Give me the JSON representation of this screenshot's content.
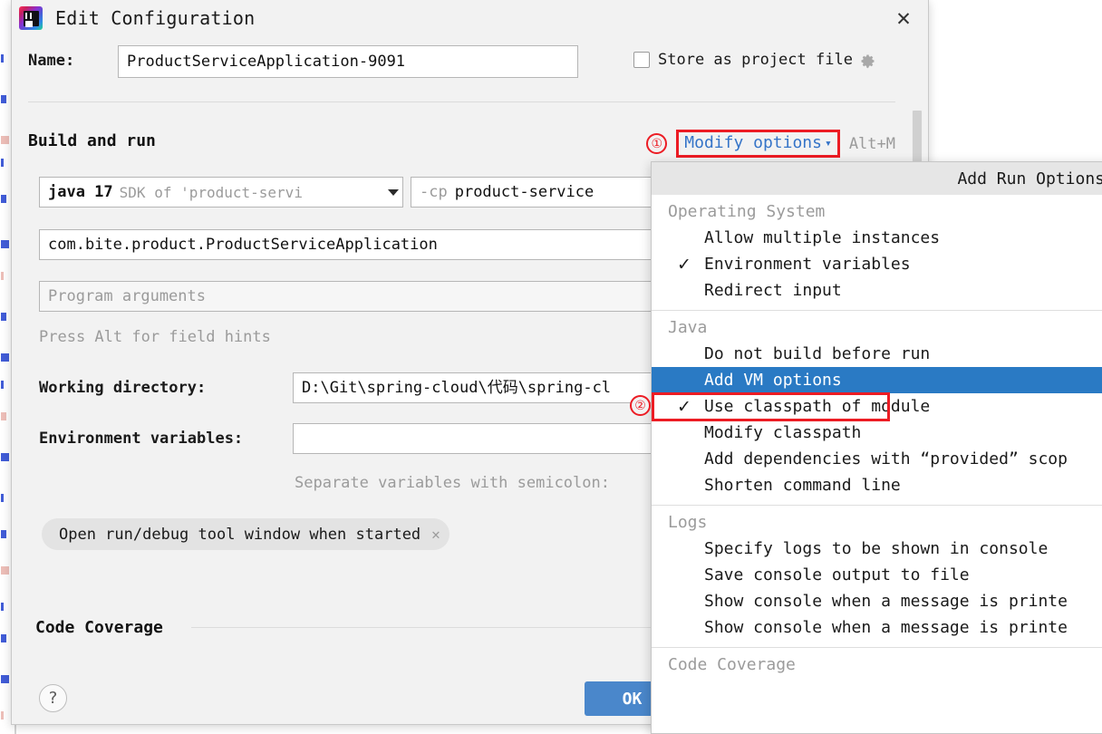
{
  "window": {
    "title": "Edit Configuration",
    "logo_icon": "intellij-idea-logo",
    "close_icon": "close-icon"
  },
  "form": {
    "name_label": "Name:",
    "name_value": "ProductServiceApplication-9091",
    "store_as_project_file_label": "Store as project file",
    "store_as_project_file_checked": false,
    "gear_icon": "gear-icon"
  },
  "build_and_run": {
    "section_title": "Build and run",
    "marker_1": "①",
    "modify_options_label": "Modify options",
    "chevron_icon": "chevron-down-icon",
    "shortcut": "Alt+M",
    "sdk_main": "java 17",
    "sdk_sub": "SDK of 'product-servi",
    "cp_flag": "-cp",
    "cp_value": "product-service",
    "main_class": "com.bite.product.ProductServiceApplication",
    "program_arguments_placeholder": "Program arguments",
    "field_hint": "Press Alt for field hints",
    "working_directory_label": "Working directory:",
    "working_directory_value": "D:\\Git\\spring-cloud\\代码\\spring-cl",
    "marker_2": "②",
    "environment_variables_label": "Environment variables:",
    "environment_variables_value": "",
    "separator_hint": "Separate variables with semicolon:",
    "chip_label": "Open run/debug tool window when started",
    "chip_close_icon": "close-icon"
  },
  "code_coverage": {
    "section_title": "Code Coverage"
  },
  "footer": {
    "help_label": "?",
    "ok_label": "OK"
  },
  "popup": {
    "header": "Add Run Options",
    "selected_item": "Add VM options",
    "groups": [
      {
        "label": "Operating System",
        "items": [
          {
            "label": "Allow multiple instances",
            "checked": false,
            "selected": false
          },
          {
            "label": "Environment variables",
            "checked": true,
            "selected": false
          },
          {
            "label": "Redirect input",
            "checked": false,
            "selected": false
          }
        ]
      },
      {
        "label": "Java",
        "items": [
          {
            "label": "Do not build before run",
            "checked": false,
            "selected": false
          },
          {
            "label": "Add VM options",
            "checked": false,
            "selected": true
          },
          {
            "label": "Use classpath of module",
            "checked": true,
            "selected": false
          },
          {
            "label": "Modify classpath",
            "checked": false,
            "selected": false
          },
          {
            "label": "Add dependencies with “provided” scop",
            "checked": false,
            "selected": false
          },
          {
            "label": "Shorten command line",
            "checked": false,
            "selected": false
          }
        ]
      },
      {
        "label": "Logs",
        "items": [
          {
            "label": "Specify logs to be shown in console",
            "checked": false,
            "selected": false
          },
          {
            "label": "Save console output to file",
            "checked": false,
            "selected": false
          },
          {
            "label": "Show console when a message is printe",
            "checked": false,
            "selected": false
          },
          {
            "label": "Show console when a message is printe",
            "checked": false,
            "selected": false
          }
        ]
      },
      {
        "label": "Code Coverage",
        "items": []
      }
    ]
  },
  "colors": {
    "accent_blue": "#3574c8",
    "highlight_blue": "#2a7ac4",
    "annotation_red": "#ec1c24",
    "dialog_bg": "#f2f2f2",
    "ok_button": "#4a87cb"
  }
}
